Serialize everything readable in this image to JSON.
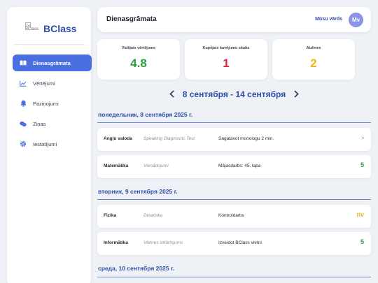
{
  "sidebar": {
    "logo_alt": "BClass",
    "logo_text": "BClass",
    "items": [
      {
        "label": "Dienasgrāmata",
        "icon": "book-icon",
        "active": true
      },
      {
        "label": "Vērtējumi",
        "icon": "chart-line-icon",
        "active": false
      },
      {
        "label": "Paziņojumi",
        "icon": "bell-icon",
        "active": false
      },
      {
        "label": "Ziņas",
        "icon": "chat-bubbles-icon",
        "active": false
      },
      {
        "label": "Iestatījumi",
        "icon": "gear-icon",
        "active": false
      }
    ]
  },
  "header": {
    "title": "Dienasgrāmata",
    "user_name": "Mūsu vārds",
    "avatar_initials": "Mv"
  },
  "stats": [
    {
      "label": "Vidējais vērtējums",
      "value": "4.8",
      "color": "#2e9d3f"
    },
    {
      "label": "Kopējais kavējumu skaits",
      "value": "1",
      "color": "#d6263a"
    },
    {
      "label": "Atzīmes",
      "value": "2",
      "color": "#f0b41c"
    }
  ],
  "week": {
    "label": "8 сентября - 14 сентября",
    "prev_icon": "chevron-left-icon",
    "next_icon": "chevron-right-icon"
  },
  "days": [
    {
      "heading": "понедельник, 8 сентября 2025 г.",
      "lessons": [
        {
          "subject": "Angļu valoda",
          "topic": "Speaking Diagnostic Test",
          "homework": "Sagatavot monologu 2 min.",
          "grade": "-",
          "grade_color": "#3b4256"
        },
        {
          "subject": "Matemātika",
          "topic": "Vienādojumi",
          "homework": "Mājasdarbs: 45. lapa",
          "grade": "5",
          "grade_color": "#2e9d3f"
        }
      ]
    },
    {
      "heading": "вторник, 9 сентября 2025 г.",
      "lessons": [
        {
          "subject": "Fizika",
          "topic": "Dinamika",
          "homework": "Kontroldarbs",
          "grade": "nv",
          "grade_color": "#f0b41c"
        },
        {
          "subject": "Informātika",
          "topic": "Vietnes izkārtojums",
          "homework": "Izveidot BClass vietni",
          "grade": "5",
          "grade_color": "#2e9d3f"
        }
      ]
    },
    {
      "heading": "среда, 10 сентября 2025 г.",
      "lessons": []
    }
  ],
  "colors": {
    "accent": "#4a6fe0",
    "brand": "#2f4ea8",
    "background": "#eef1f6"
  }
}
